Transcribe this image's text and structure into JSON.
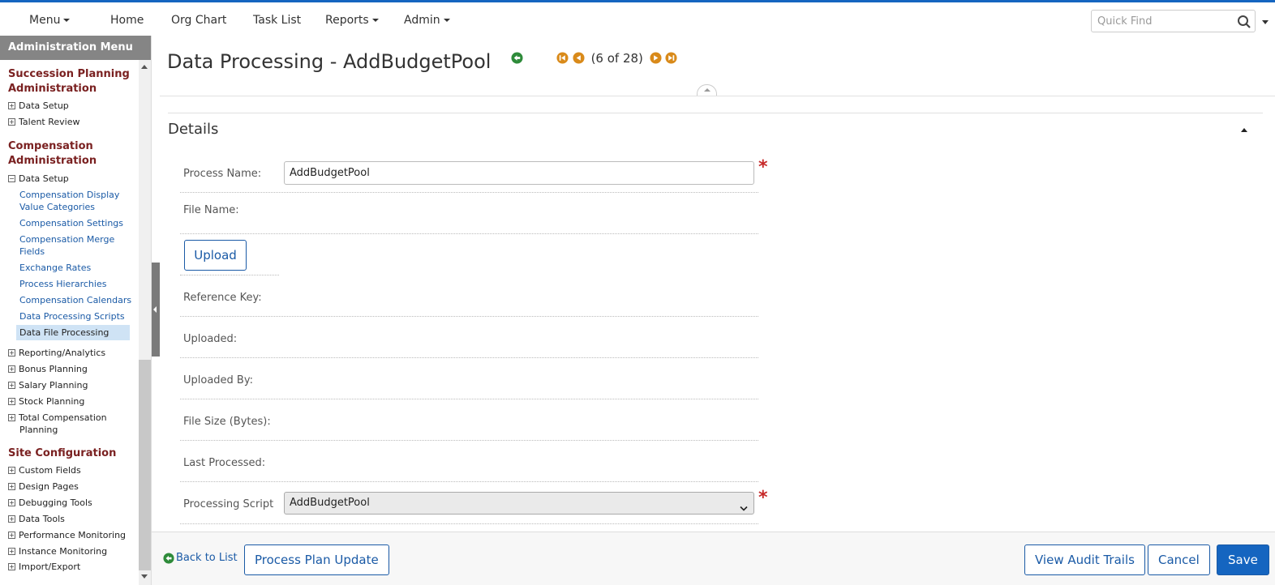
{
  "topnav": {
    "menu": "Menu",
    "home": "Home",
    "org_chart": "Org Chart",
    "task_list": "Task List",
    "reports": "Reports",
    "admin": "Admin",
    "quick_find_placeholder": "Quick Find"
  },
  "sidebar": {
    "header": "Administration Menu",
    "succession": {
      "title": "Succession Planning Administration",
      "items": [
        "Data Setup",
        "Talent Review"
      ]
    },
    "compensation": {
      "title": "Compensation Administration",
      "data_setup": "Data Setup",
      "links": [
        "Compensation Display Value Categories",
        "Compensation Settings",
        "Compensation Merge Fields",
        "Exchange Rates",
        "Process Hierarchies",
        "Compensation Calendars",
        "Data Processing Scripts",
        "Data File Processing"
      ],
      "items": [
        "Reporting/Analytics",
        "Bonus Planning",
        "Salary Planning",
        "Stock Planning",
        "Total Compensation Planning"
      ]
    },
    "site_config": {
      "title": "Site Configuration",
      "items": [
        "Custom Fields",
        "Design Pages",
        "Debugging Tools",
        "Data Tools",
        "Performance Monitoring",
        "Instance Monitoring",
        "Import/Export"
      ]
    }
  },
  "page": {
    "title": "Data Processing - AddBudgetPool",
    "pager_text": "(6 of 28)",
    "details_title": "Details"
  },
  "form": {
    "process_name_label": "Process Name:",
    "process_name_value": "AddBudgetPool",
    "file_name_label": "File Name:",
    "upload_label": "Upload",
    "reference_key_label": "Reference Key:",
    "uploaded_label": "Uploaded:",
    "uploaded_by_label": "Uploaded By:",
    "file_size_label": "File Size (Bytes):",
    "last_processed_label": "Last Processed:",
    "processing_script_label": "Processing Script",
    "processing_script_value": "AddBudgetPool",
    "required_mark": "*"
  },
  "footer": {
    "back": "Back to List",
    "process_plan_update": "Process Plan Update",
    "view_audit_trails": "View Audit Trails",
    "cancel": "Cancel",
    "save": "Save"
  },
  "colors": {
    "accent": "#1565c0",
    "section_title": "#7a2121",
    "nav_icon_orange": "#d98a1a",
    "back_icon_green": "#2e8b3a",
    "required": "#c62828"
  }
}
